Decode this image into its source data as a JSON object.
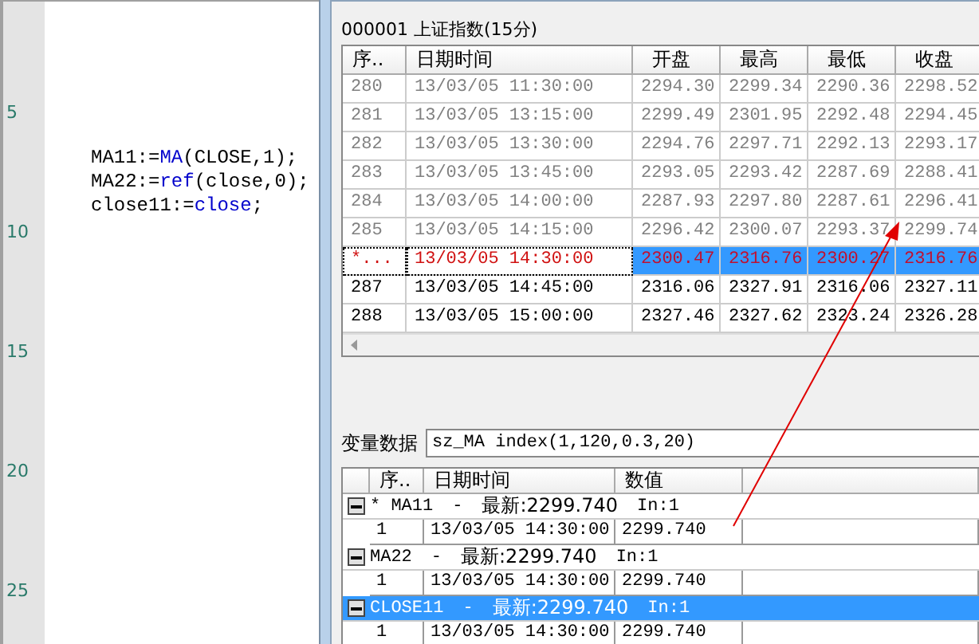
{
  "editor": {
    "line_numbers": [
      "5",
      "10",
      "15",
      "20",
      "25"
    ],
    "code_lines": [
      [
        {
          "text": "MA11:=",
          "kind": "plain"
        },
        {
          "text": "MA",
          "kind": "keyword"
        },
        {
          "text": "(CLOSE,1);",
          "kind": "plain"
        }
      ],
      [
        {
          "text": "MA22:=",
          "kind": "plain"
        },
        {
          "text": "ref",
          "kind": "keyword"
        },
        {
          "text": "(close,0);",
          "kind": "plain"
        }
      ],
      [
        {
          "text": "close11:=",
          "kind": "plain"
        },
        {
          "text": "close",
          "kind": "keyword"
        },
        {
          "text": ";",
          "kind": "plain"
        }
      ]
    ]
  },
  "window": {
    "security": "000001 上证指数(15分)",
    "quote_table": {
      "columns": [
        "序..",
        "日期时间",
        "开盘",
        "最高",
        "最低",
        "收盘"
      ],
      "rows": [
        {
          "cells": [
            "280",
            "13/03/05 11:30:00",
            "2294.30",
            "2299.34",
            "2290.36",
            "2298.52"
          ],
          "kind": "past",
          "selected": false
        },
        {
          "cells": [
            "281",
            "13/03/05 13:15:00",
            "2299.49",
            "2301.95",
            "2292.48",
            "2294.45"
          ],
          "kind": "past",
          "selected": false
        },
        {
          "cells": [
            "282",
            "13/03/05 13:30:00",
            "2294.76",
            "2297.71",
            "2292.13",
            "2293.17"
          ],
          "kind": "past",
          "selected": false
        },
        {
          "cells": [
            "283",
            "13/03/05 13:45:00",
            "2293.05",
            "2293.42",
            "2287.69",
            "2288.41"
          ],
          "kind": "past",
          "selected": false
        },
        {
          "cells": [
            "284",
            "13/03/05 14:00:00",
            "2287.93",
            "2297.80",
            "2287.61",
            "2296.41"
          ],
          "kind": "past",
          "selected": false
        },
        {
          "cells": [
            "285",
            "13/03/05 14:15:00",
            "2296.42",
            "2300.07",
            "2293.37",
            "2299.74"
          ],
          "kind": "past",
          "selected": false
        },
        {
          "cells": [
            "*...",
            "13/03/05 14:30:00",
            "2300.47",
            "2316.76",
            "2300.27",
            "2316.76"
          ],
          "kind": "current",
          "selected": true
        },
        {
          "cells": [
            "287",
            "13/03/05 14:45:00",
            "2316.06",
            "2327.91",
            "2316.06",
            "2327.11"
          ],
          "kind": "future",
          "selected": false
        },
        {
          "cells": [
            "288",
            "13/03/05 15:00:00",
            "2327.46",
            "2327.62",
            "2323.24",
            "2326.28"
          ],
          "kind": "future",
          "selected": false
        }
      ]
    },
    "variable_label": "变量数据",
    "variable_formula": "sz_MA index(1,120,0.3,20)",
    "variable_table": {
      "columns": [
        "序..",
        "日期时间",
        "数值"
      ],
      "groups": [
        {
          "name": "* MA11",
          "separator": "-",
          "latest": "最新:2299.740",
          "input": "In:1",
          "expanded": true,
          "selected": false,
          "rows": [
            [
              "1",
              "13/03/05 14:30:00",
              "2299.740"
            ]
          ]
        },
        {
          "name": "MA22",
          "separator": "-",
          "latest": "最新:2299.740",
          "input": "In:1",
          "expanded": true,
          "selected": false,
          "rows": [
            [
              "1",
              "13/03/05 14:30:00",
              "2299.740"
            ]
          ]
        },
        {
          "name": "CLOSE11",
          "separator": "-",
          "latest": "最新:2299.740",
          "input": "In:1",
          "expanded": true,
          "selected": true,
          "rows": [
            [
              "1",
              "13/03/05 14:30:00",
              "2299.740"
            ]
          ]
        }
      ]
    }
  }
}
